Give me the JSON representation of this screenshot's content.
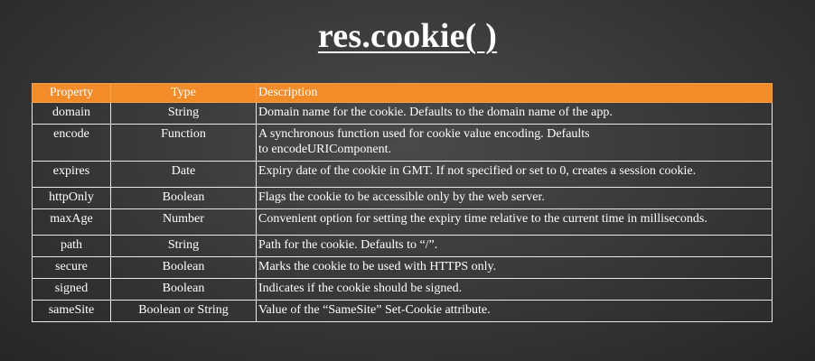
{
  "title": "res.cookie( )",
  "table": {
    "headers": [
      "Property",
      "Type",
      "Description"
    ],
    "rows": [
      {
        "property": "domain",
        "type": "String",
        "description": "Domain name for the cookie. Defaults to the domain name of the app."
      },
      {
        "property": "encode",
        "type": "Function",
        "description": "A synchronous function used for cookie value encoding. Defaults\nto encodeURIComponent."
      },
      {
        "property": "expires",
        "type": "Date",
        "description": "Expiry date of the cookie in GMT. If not specified or set to 0, creates a session cookie."
      },
      {
        "property": "httpOnly",
        "type": "Boolean",
        "description": "Flags the cookie to be accessible only by the web server."
      },
      {
        "property": "maxAge",
        "type": "Number",
        "description": "Convenient option for setting the expiry time relative to the current time in milliseconds."
      },
      {
        "property": "path",
        "type": "String",
        "description": "Path for the cookie. Defaults to “/”."
      },
      {
        "property": "secure",
        "type": "Boolean",
        "description": "Marks the cookie to be used with HTTPS only."
      },
      {
        "property": "signed",
        "type": "Boolean",
        "description": "Indicates if the cookie should be signed."
      },
      {
        "property": "sameSite",
        "type": "Boolean or String",
        "description": "Value of the “SameSite” Set-Cookie attribute."
      }
    ]
  }
}
